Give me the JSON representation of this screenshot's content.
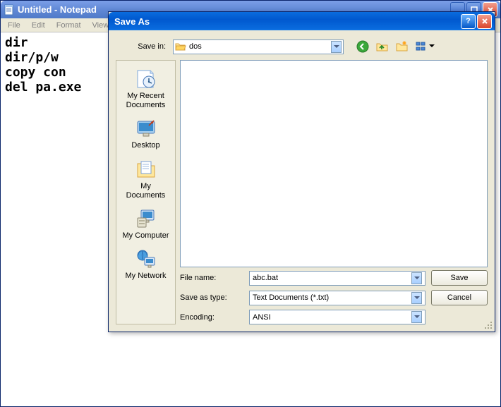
{
  "notepad": {
    "title": "Untitled - Notepad",
    "menu": {
      "file": "File",
      "edit": "Edit",
      "format": "Format",
      "view": "View"
    },
    "content": "dir\ndir/p/w\ncopy con\ndel pa.exe"
  },
  "dialog": {
    "title": "Save As",
    "savein_label": "Save in:",
    "savein_value": "dos",
    "places": {
      "recent": "My Recent Documents",
      "desktop": "Desktop",
      "mydocs": "My Documents",
      "mycomp": "My Computer",
      "mynet": "My Network"
    },
    "filename_label": "File name:",
    "filename_value": "abc.bat",
    "saveastype_label": "Save as type:",
    "saveastype_value": "Text Documents (*.txt)",
    "encoding_label": "Encoding:",
    "encoding_value": "ANSI",
    "save_btn": "Save",
    "cancel_btn": "Cancel"
  }
}
